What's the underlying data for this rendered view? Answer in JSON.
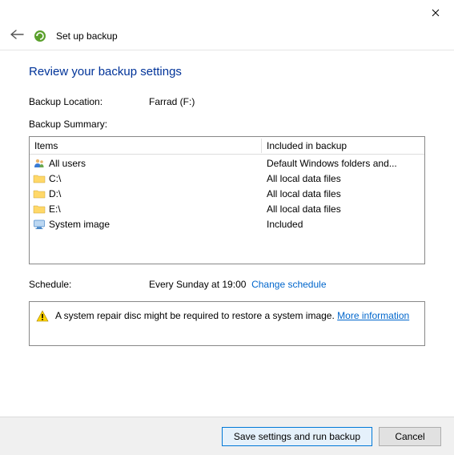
{
  "window": {
    "title": "Set up backup"
  },
  "page": {
    "heading": "Review your backup settings",
    "backup_location_label": "Backup Location:",
    "backup_location_value": "Farrad (F:)",
    "backup_summary_label": "Backup Summary:",
    "schedule_label": "Schedule:",
    "schedule_value": "Every Sunday at 19:00",
    "change_schedule": "Change schedule",
    "warning_text": "A system repair disc might be required to restore a system image. ",
    "more_info": "More information"
  },
  "columns": {
    "items": "Items",
    "included": "Included in backup"
  },
  "rows": [
    {
      "icon": "users",
      "name": "All users",
      "included": "Default Windows folders and..."
    },
    {
      "icon": "folder",
      "name": "C:\\",
      "included": "All local data files"
    },
    {
      "icon": "folder",
      "name": "D:\\",
      "included": "All local data files"
    },
    {
      "icon": "folder",
      "name": "E:\\",
      "included": "All local data files"
    },
    {
      "icon": "monitor",
      "name": "System image",
      "included": "Included"
    }
  ],
  "buttons": {
    "save": "Save settings and run backup",
    "cancel": "Cancel"
  }
}
